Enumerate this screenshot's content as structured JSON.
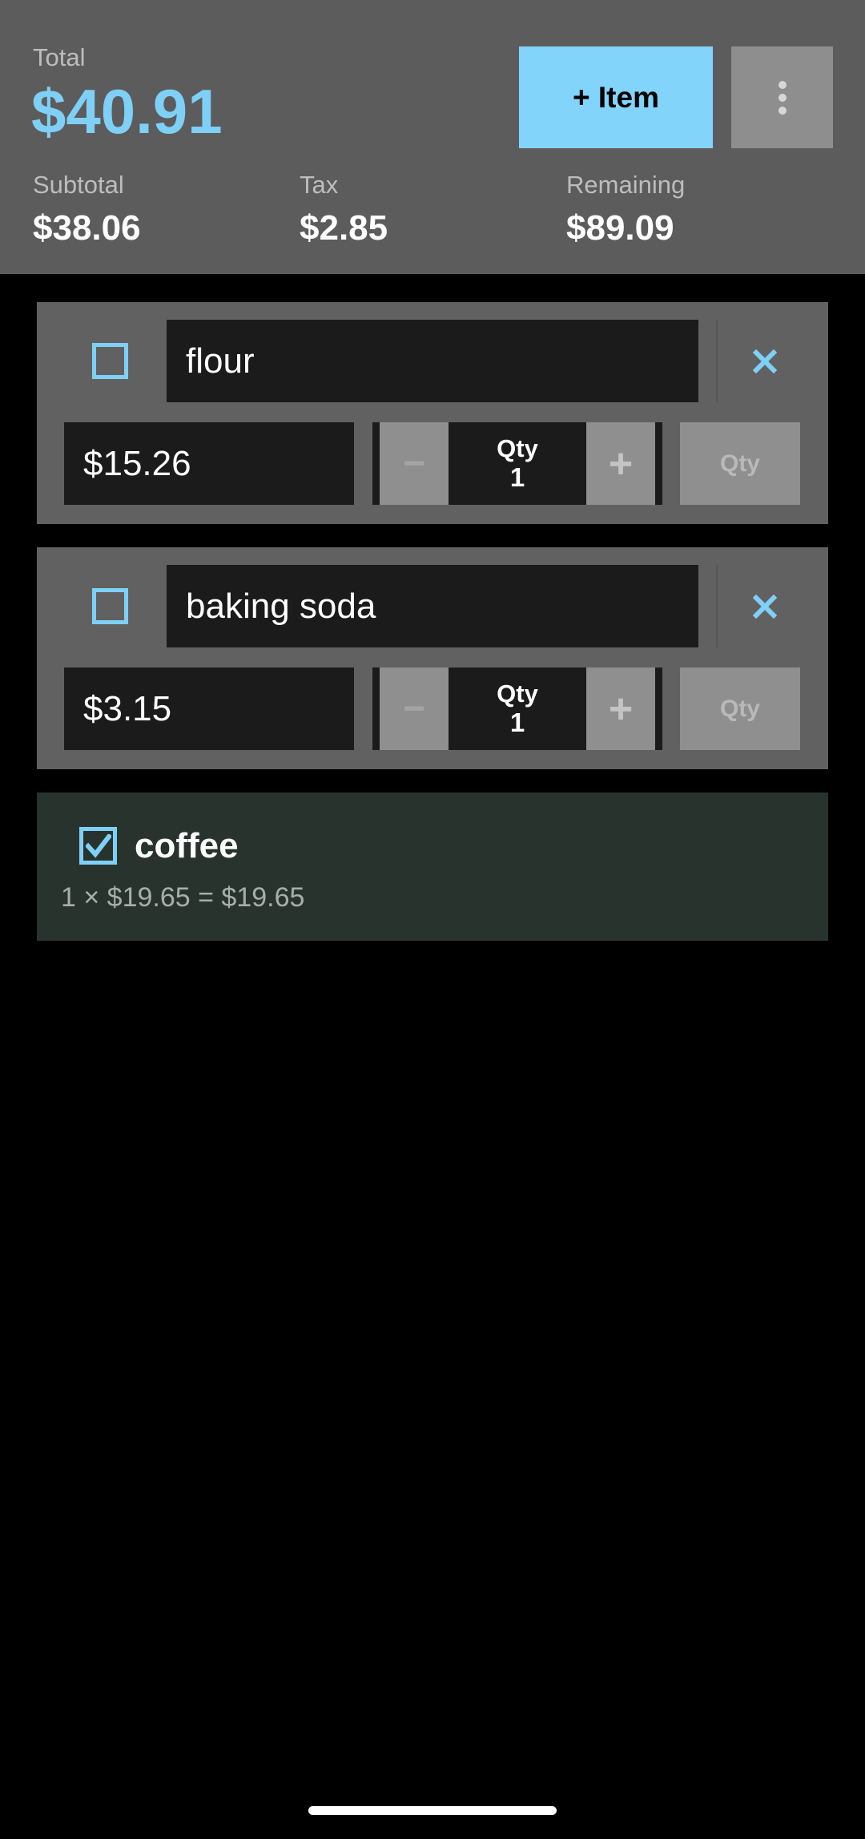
{
  "header": {
    "total_label": "Total",
    "total_value": "$40.91",
    "add_item_label": "+ Item",
    "menu_icon": "more-vertical-icon",
    "subtotal_label": "Subtotal",
    "subtotal_value": "$38.06",
    "tax_label": "Tax",
    "tax_value": "$2.85",
    "remaining_label": "Remaining",
    "remaining_value": "$89.09"
  },
  "items": [
    {
      "name": "flour",
      "price": "$15.26",
      "qty_label": "Qty",
      "qty": "1",
      "minus": "−",
      "plus": "+",
      "qty_button": "Qty",
      "checked": false
    },
    {
      "name": "baking soda",
      "price": "$3.15",
      "qty_label": "Qty",
      "qty": "1",
      "minus": "−",
      "plus": "+",
      "qty_button": "Qty",
      "checked": false
    }
  ],
  "checked_items": [
    {
      "name": "coffee",
      "detail": "1 × $19.65 = $19.65",
      "checked": true
    }
  ],
  "colors": {
    "accent": "#7fd0f6",
    "header_bg": "#5c5c5c",
    "card_bg": "#616161",
    "checked_card_bg": "#29332e",
    "background": "#000000"
  }
}
